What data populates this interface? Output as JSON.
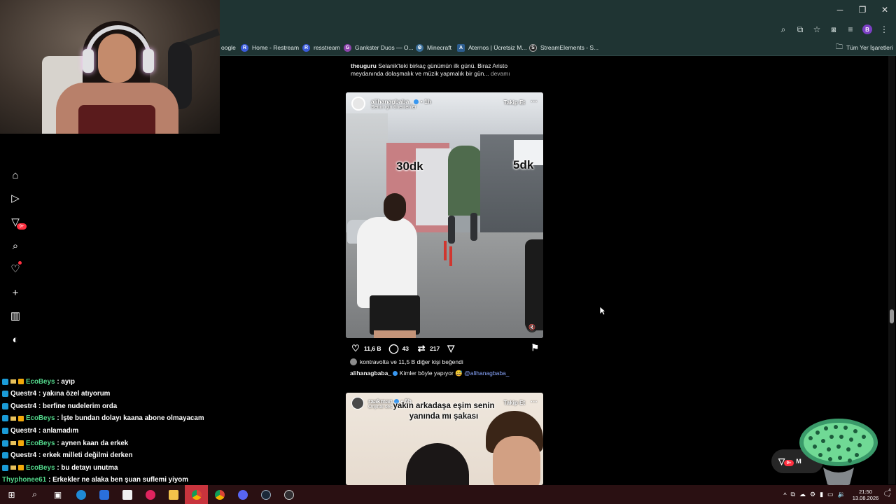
{
  "browser": {
    "window_controls": [
      "─",
      "❐",
      "✕"
    ],
    "profile_initial": "B",
    "bookmarks": [
      {
        "label": "oogle",
        "icon": "",
        "color": "#1f3433"
      },
      {
        "label": "Home - Restream",
        "icon": "R",
        "color": "#3b5bdb"
      },
      {
        "label": "resstream",
        "icon": "R",
        "color": "#3b5bdb"
      },
      {
        "label": "Gankster Duos — O...",
        "icon": "G",
        "color": "#8e44ad"
      },
      {
        "label": "Minecraft",
        "icon": "⚙",
        "color": "#3a6f9a"
      },
      {
        "label": "Aternos | Ücretsiz M...",
        "icon": "A",
        "color": "#2c5d8f"
      },
      {
        "label": "StreamElements - S...",
        "icon": "S",
        "color": "#222222"
      }
    ],
    "bookmarks_all": "Tüm Yer İşaretleri"
  },
  "chat": [
    {
      "user": "EcoBeys",
      "msg": " : ayıp",
      "badges": 3,
      "color": "green"
    },
    {
      "user": "Questr4",
      "msg": " : yakına özel atıyorum",
      "badges": 1,
      "color": "white"
    },
    {
      "user": "Questr4",
      "msg": " : berfine nudelerim orda",
      "badges": 1,
      "color": "white"
    },
    {
      "user": "EcoBeys",
      "msg": " : İşte bundan dolayı kaana abone olmayacam",
      "badges": 3,
      "color": "green"
    },
    {
      "user": "Questr4",
      "msg": " : anlamadım",
      "badges": 1,
      "color": "white"
    },
    {
      "user": "EcoBeys",
      "msg": " : aynen kaan da erkek",
      "badges": 3,
      "color": "green"
    },
    {
      "user": "Questr4",
      "msg": " : erkek milleti değilmi derken",
      "badges": 1,
      "color": "white"
    },
    {
      "user": "EcoBeys",
      "msg": " : bu detayı unutma",
      "badges": 3,
      "color": "green"
    },
    {
      "user": "Thyphonee61",
      "msg": " : Erkekler ne alaka ben şuan suflemi yiyom",
      "badges": 0,
      "color": "green"
    }
  ],
  "sidebar": {
    "notif_badge": "9+"
  },
  "feed": {
    "prev_caption": {
      "user": "theuguru",
      "text": " Selanik'teki birkaç günümün ilk günü. Biraz Aristo",
      "line2": "meydanında dolaşmalık ve müzik yapmalık bir gün...",
      "more": " devamı"
    },
    "post1": {
      "user": "alihanagbaba_",
      "time": " • 1h",
      "subtitle": "Senin için önerilenler",
      "follow": "Takip Et",
      "more": "···",
      "overlay_left": "30dk",
      "overlay_right": "5dk",
      "likes": "11,6 B",
      "comments": "43",
      "reposts": "217",
      "liked_by": "kontravolta ve 11,5 B diğer kişi beğendi",
      "caption_user": "alihanagbaba_",
      "caption_text": " Kimler böyle yapıyor 😅 ",
      "caption_mention": "@alihanagbaba_"
    },
    "post2": {
      "user": "raakman",
      "time": " • 6h",
      "subtitle": "Orijinal ses",
      "follow": "Takip Et",
      "more": "···",
      "overlay_line1": "yakın arkadaşa eşim senin",
      "overlay_line2": "yanında mı şakası"
    }
  },
  "messages_button": {
    "label": "M",
    "badge": "9+"
  },
  "taskbar": {
    "time": "21:50",
    "date": "13.08.2026",
    "notif_count": "4"
  }
}
